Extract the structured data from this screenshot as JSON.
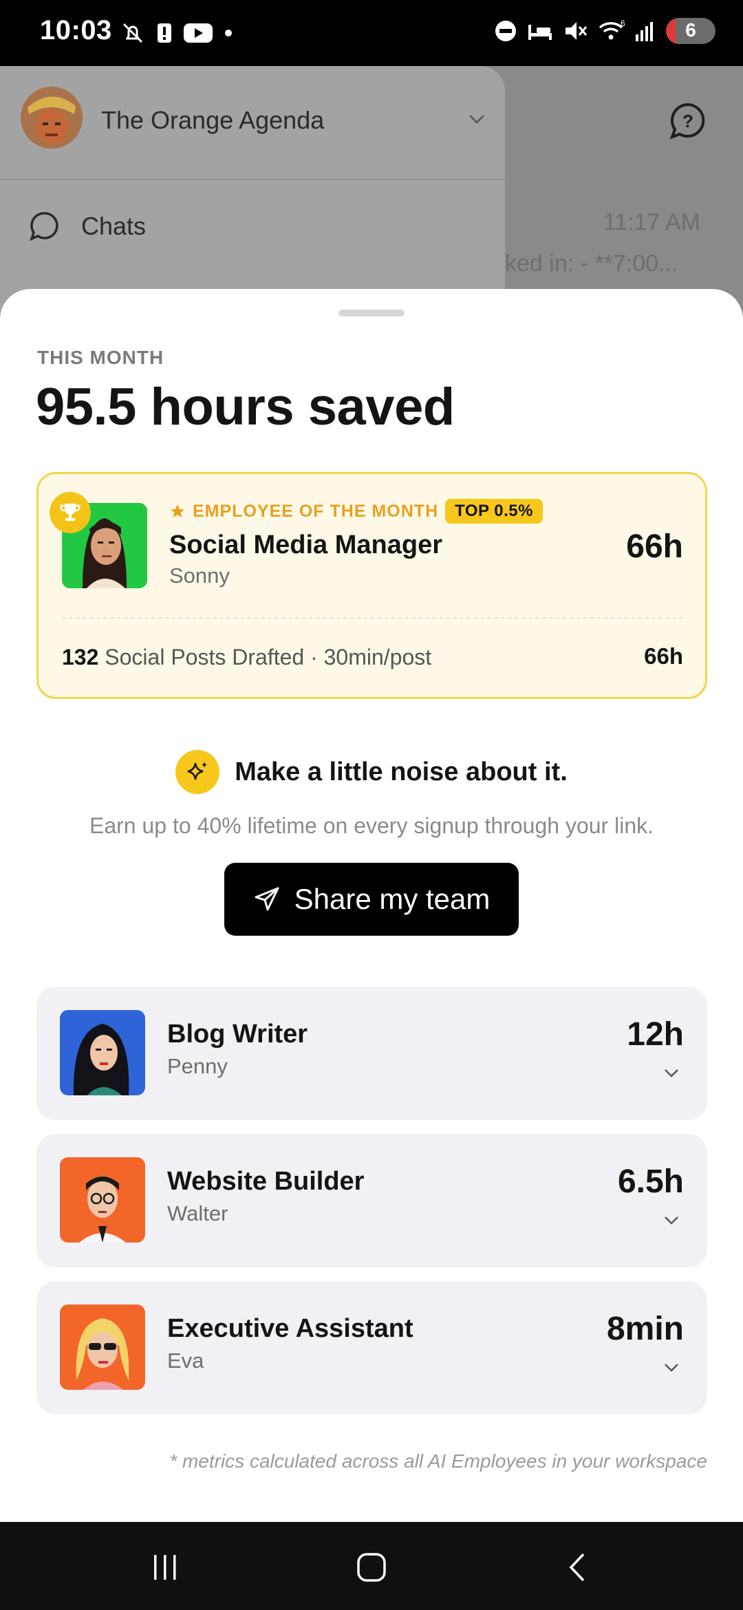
{
  "status_bar": {
    "time": "10:03",
    "battery_level": "6"
  },
  "background_app": {
    "workspace_name": "The Orange Agenda",
    "chats_label": "Chats",
    "chat_time": "11:17 AM",
    "chat_preview": "ked in: - **7:00..."
  },
  "sheet": {
    "eyebrow": "THIS MONTH",
    "headline": "95.5 hours saved",
    "employee_of_month": {
      "label": "EMPLOYEE OF THE MONTH",
      "top_badge": "TOP 0.5%",
      "role": "Social Media Manager",
      "name": "Sonny",
      "hours": "66h",
      "metric_count": "132",
      "metric_text": "Social Posts Drafted · 30min/post",
      "metric_hours": "66h"
    },
    "share": {
      "title": "Make a little noise about it.",
      "subtitle": "Earn up to 40% lifetime on every signup through your link.",
      "button_label": "Share my team"
    },
    "employees": [
      {
        "role": "Blog Writer",
        "name": "Penny",
        "hours": "12h"
      },
      {
        "role": "Website Builder",
        "name": "Walter",
        "hours": "6.5h"
      },
      {
        "role": "Executive Assistant",
        "name": "Eva",
        "hours": "8min"
      }
    ],
    "footnote": "* metrics calculated across all AI Employees in your workspace"
  },
  "colors": {
    "accent_yellow": "#f7c81b",
    "eom_background": "#fef9e6",
    "eom_border": "#f1d64a",
    "eom_label": "#e8a020"
  },
  "icons": {
    "status_left": [
      "notifications-off-icon",
      "alert-icon",
      "youtube-icon",
      "dot-icon"
    ],
    "status_right": [
      "dnd-icon",
      "sleep-icon",
      "mute-icon",
      "wifi-icon",
      "signal-icon",
      "battery-icon"
    ],
    "nav": [
      "recents-icon",
      "home-icon",
      "back-icon"
    ]
  }
}
